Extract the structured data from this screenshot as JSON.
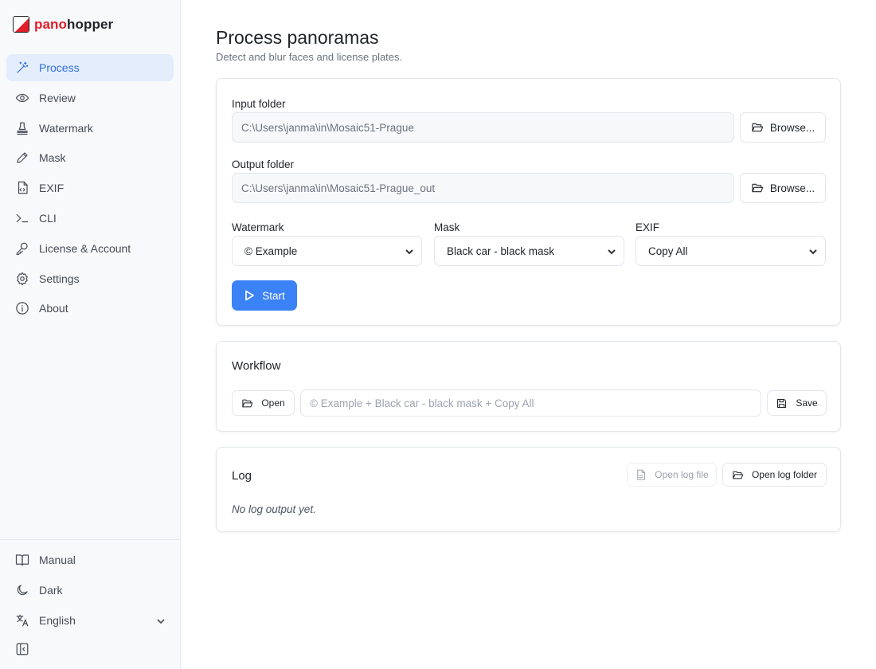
{
  "brand": {
    "part1": "pano",
    "part2": "hopper"
  },
  "sidebar": {
    "items": [
      {
        "label": "Process",
        "icon": "wand-icon",
        "active": true
      },
      {
        "label": "Review",
        "icon": "eye-icon"
      },
      {
        "label": "Watermark",
        "icon": "stamp-icon"
      },
      {
        "label": "Mask",
        "icon": "pencil-icon"
      },
      {
        "label": "EXIF",
        "icon": "file-code-icon"
      },
      {
        "label": "CLI",
        "icon": "terminal-icon"
      },
      {
        "label": "License & Account",
        "icon": "key-icon"
      },
      {
        "label": "Settings",
        "icon": "gear-icon"
      },
      {
        "label": "About",
        "icon": "info-icon"
      }
    ],
    "bottom": {
      "manual": "Manual",
      "theme": "Dark",
      "language": "English"
    }
  },
  "page": {
    "title": "Process panoramas",
    "subtitle": "Detect and blur faces and license plates."
  },
  "process": {
    "input_label": "Input folder",
    "input_value": "C:\\Users\\janma\\in\\Mosaic51-Prague",
    "output_label": "Output folder",
    "output_value": "C:\\Users\\janma\\in\\Mosaic51-Prague_out",
    "browse_label": "Browse...",
    "watermark_label": "Watermark",
    "watermark_value": "© Example",
    "mask_label": "Mask",
    "mask_value": "Black car - black mask",
    "exif_label": "EXIF",
    "exif_value": "Copy All",
    "start_label": "Start"
  },
  "workflow": {
    "title": "Workflow",
    "open_label": "Open",
    "placeholder": "© Example + Black car - black mask + Copy All",
    "save_label": "Save"
  },
  "log": {
    "title": "Log",
    "open_file_label": "Open log file",
    "open_folder_label": "Open log folder",
    "empty_text": "No log output yet."
  },
  "colors": {
    "accent": "#3b82f6",
    "active_nav_bg": "#e3edfb",
    "active_nav_text": "#2f6fdb",
    "brand_red": "#e11d2a"
  }
}
